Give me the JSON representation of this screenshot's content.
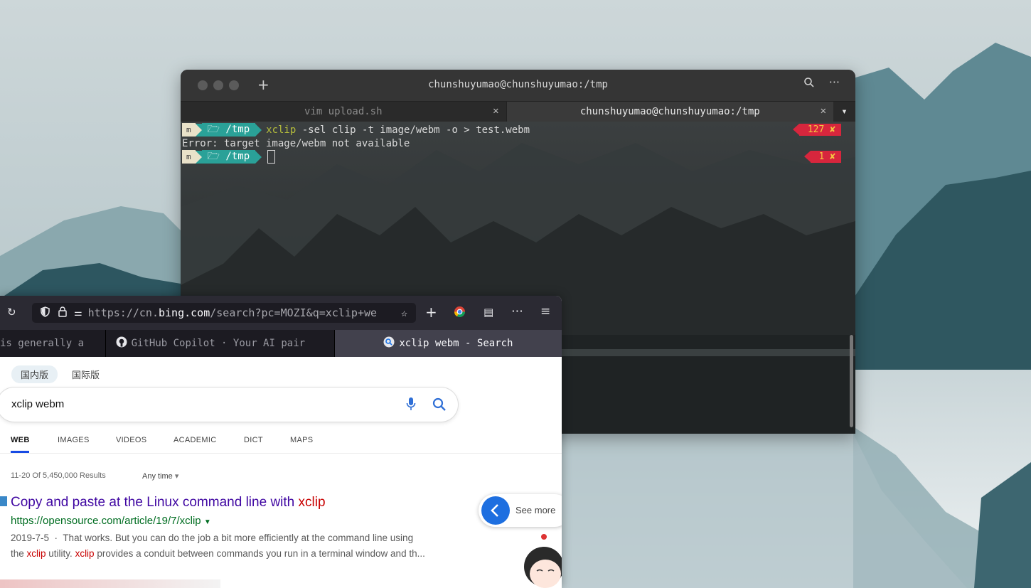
{
  "terminal": {
    "title": "chunshuyumao@chunshuyumao:/tmp",
    "tabs": [
      {
        "label": "vim upload.sh",
        "active": false
      },
      {
        "label": "chunshuyumao@chunshuyumao:/tmp",
        "active": true
      }
    ],
    "prompt": {
      "mode": "m",
      "dir": "/tmp"
    },
    "lines": {
      "cmd_name": "xclip",
      "cmd_args": " -sel clip -t image/webm -o > test.webm",
      "status1": "127 ✘",
      "error": "Error: target image/webm not available",
      "status2": "1 ✘"
    }
  },
  "browser": {
    "url": {
      "prefix": "https://cn.",
      "domain": "bing.com",
      "path": "/search?pc=MOZI&q=xclip+we"
    },
    "tabs": [
      {
        "label": "is generally a"
      },
      {
        "label": "GitHub Copilot · Your AI pair"
      },
      {
        "label": "xclip webm - Search",
        "active": true
      }
    ],
    "page": {
      "region_tabs": [
        "国内版",
        "国际版"
      ],
      "query": "xclip webm",
      "nav": [
        "WEB",
        "IMAGES",
        "VIDEOS",
        "ACADEMIC",
        "DICT",
        "MAPS"
      ],
      "results_count": "11-20 Of 5,450,000 Results",
      "time_filter": "Any time",
      "result1": {
        "title_pre": "Copy and paste at the Linux command line with ",
        "title_hl": "xclip",
        "url": "https://opensource.com/article/19/7/xclip",
        "date": "2019-7-5",
        "snippet1": "That works. But you can do the job a bit more efficiently at the command line using",
        "snippet2_a": "the ",
        "snippet2_hl1": "xclip",
        "snippet2_b": " utility. ",
        "snippet2_hl2": "xclip",
        "snippet2_c": " provides a conduit between commands you run in a terminal window and th..."
      },
      "see_more": "See more"
    }
  },
  "colors": {
    "accent_teal": "#2aa198",
    "error_red": "#d7263d",
    "bing_blue": "#1a73e8"
  }
}
